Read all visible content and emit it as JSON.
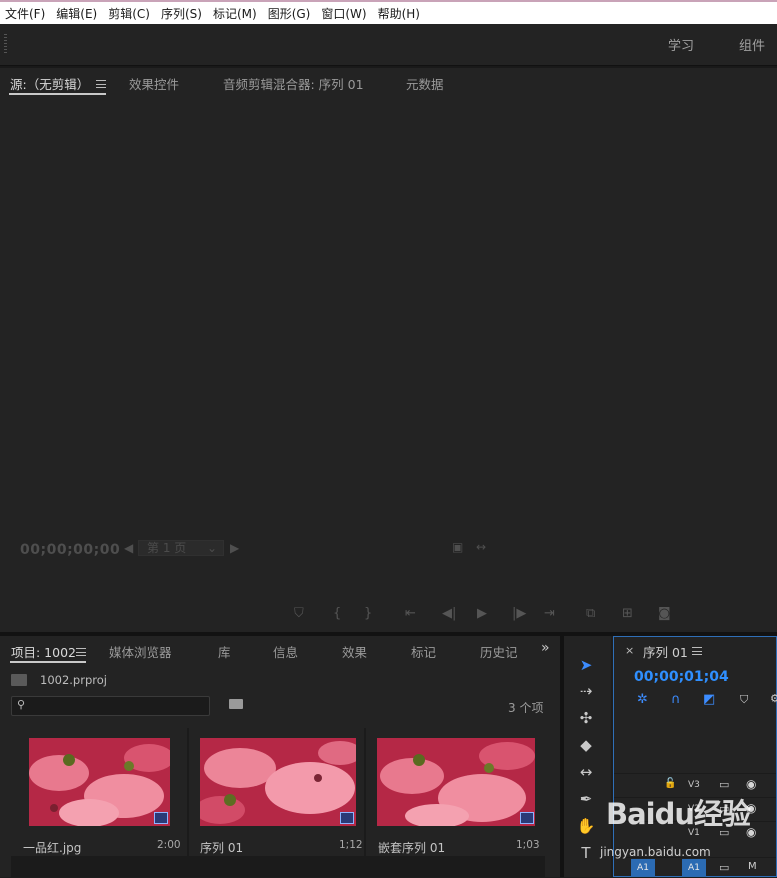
{
  "menu": [
    "文件(F)",
    "编辑(E)",
    "剪辑(C)",
    "序列(S)",
    "标记(M)",
    "图形(G)",
    "窗口(W)",
    "帮助(H)"
  ],
  "workspaces": {
    "learn": "学习",
    "assemble": "组件"
  },
  "source_panel": {
    "tabs": [
      "源:（无剪辑）",
      "效果控件",
      "音频剪辑混合器: 序列 01",
      "元数据"
    ],
    "timecode": "00;00;00;00",
    "page_select": "第 1 页"
  },
  "project_panel": {
    "tabs": [
      "项目: 1002",
      "媒体浏览器",
      "库",
      "信息",
      "效果",
      "标记",
      "历史记"
    ],
    "project_file": "1002.prproj",
    "item_count": "3 个项",
    "items": [
      {
        "name": "一品红.jpg",
        "duration": "2:00"
      },
      {
        "name": "序列 01",
        "duration": "1;12"
      },
      {
        "name": "嵌套序列 01",
        "duration": "1;03"
      }
    ]
  },
  "timeline": {
    "close": "×",
    "tab": "序列 01",
    "timecode": "00;00;01;04",
    "tracks": [
      "V3",
      "V2",
      "V1",
      "A1"
    ],
    "a1_src": "A1",
    "a1_mute": "M"
  },
  "watermark": {
    "brand": "Baidu经验",
    "url": "jingyan.baidu.com"
  },
  "colors": {
    "accent_blue": "#2f8fff",
    "panel_bg": "#232323",
    "selection_outline": "#2f6fb8"
  }
}
